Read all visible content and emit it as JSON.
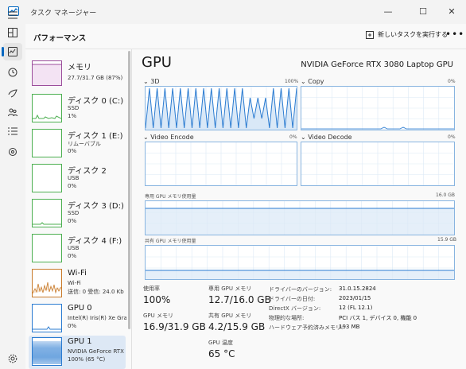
{
  "window": {
    "title": "タスク マネージャー",
    "minimize": "—",
    "maximize": "☐",
    "close": "✕"
  },
  "header": {
    "title": "パフォーマンス",
    "run_task": "新しいタスクを実行する",
    "more": "•••"
  },
  "nav_icons": [
    "hamburger-icon",
    "processes-icon",
    "performance-icon",
    "history-icon",
    "startup-icon",
    "users-icon",
    "details-icon",
    "services-icon",
    "settings-icon"
  ],
  "perf_items": [
    {
      "name": "メモリ",
      "sub1": "27.7/31.7 GB (87%)",
      "sub2": "",
      "color": "#9b4d9b"
    },
    {
      "name": "ディスク 0 (C:)",
      "sub1": "SSD",
      "sub2": "1%",
      "color": "#4caf50"
    },
    {
      "name": "ディスク 1 (E:)",
      "sub1": "リムーバブル",
      "sub2": "0%",
      "color": "#4caf50"
    },
    {
      "name": "ディスク 2",
      "sub1": "USB",
      "sub2": "0%",
      "color": "#4caf50"
    },
    {
      "name": "ディスク 3 (D:)",
      "sub1": "SSD",
      "sub2": "0%",
      "color": "#4caf50"
    },
    {
      "name": "ディスク 4 (F:)",
      "sub1": "USB",
      "sub2": "0%",
      "color": "#4caf50"
    },
    {
      "name": "Wi-Fi",
      "sub1": "Wi-Fi",
      "sub2": "送信: 0 受信: 24.0 Kb",
      "color": "#c87a2a"
    },
    {
      "name": "GPU 0",
      "sub1": "Intel(R) Iris(R) Xe Gra",
      "sub2": "0%",
      "color": "#2a7bd1"
    },
    {
      "name": "GPU 1",
      "sub1": "NVIDIA GeForce RTX",
      "sub2": "100% (65 °C)",
      "color": "#2a7bd1"
    }
  ],
  "gpu": {
    "title": "GPU",
    "model": "NVIDIA GeForce RTX 3080 Laptop GPU",
    "graphs": {
      "g3d": {
        "label": "3D",
        "max": "100%"
      },
      "copy": {
        "label": "Copy",
        "max": "0%"
      },
      "enc": {
        "label": "Video Encode",
        "max": "0%"
      },
      "dec": {
        "label": "Video Decode",
        "max": "0%"
      },
      "dedicated": {
        "label": "専用 GPU メモリ使用量",
        "max": "16.0 GB"
      },
      "shared": {
        "label": "共有 GPU メモリ使用量",
        "max": "15.9 GB"
      }
    },
    "stats": {
      "util_label": "使用率",
      "util_val": "100%",
      "dedmem_label": "専用 GPU メモリ",
      "dedmem_val": "12.7/16.0 GB",
      "gpumem_label": "GPU メモリ",
      "gpumem_val": "16.9/31.9 GB",
      "sharedmem_label": "共有 GPU メモリ",
      "sharedmem_val": "4.2/15.9 GB",
      "temp_label": "GPU 温度",
      "temp_val": "65 °C"
    },
    "props": [
      {
        "label": "ドライバーのバージョン:",
        "value": "31.0.15.2824"
      },
      {
        "label": "ドライバーの日付:",
        "value": "2023/01/15"
      },
      {
        "label": "DirectX バージョン:",
        "value": "12 (FL 12.1)"
      },
      {
        "label": "物理的な場所:",
        "value": "PCI バス 1, デバイス 0, 機能 0"
      },
      {
        "label": "ハードウェア予約済みメモリ:",
        "value": "193 MB"
      }
    ]
  },
  "colors": {
    "gpu_line": "#2a7bd1",
    "mem_line": "#9b4d9b",
    "disk_line": "#4caf50",
    "wifi_line": "#c87a2a",
    "accent": "#0067c0"
  }
}
